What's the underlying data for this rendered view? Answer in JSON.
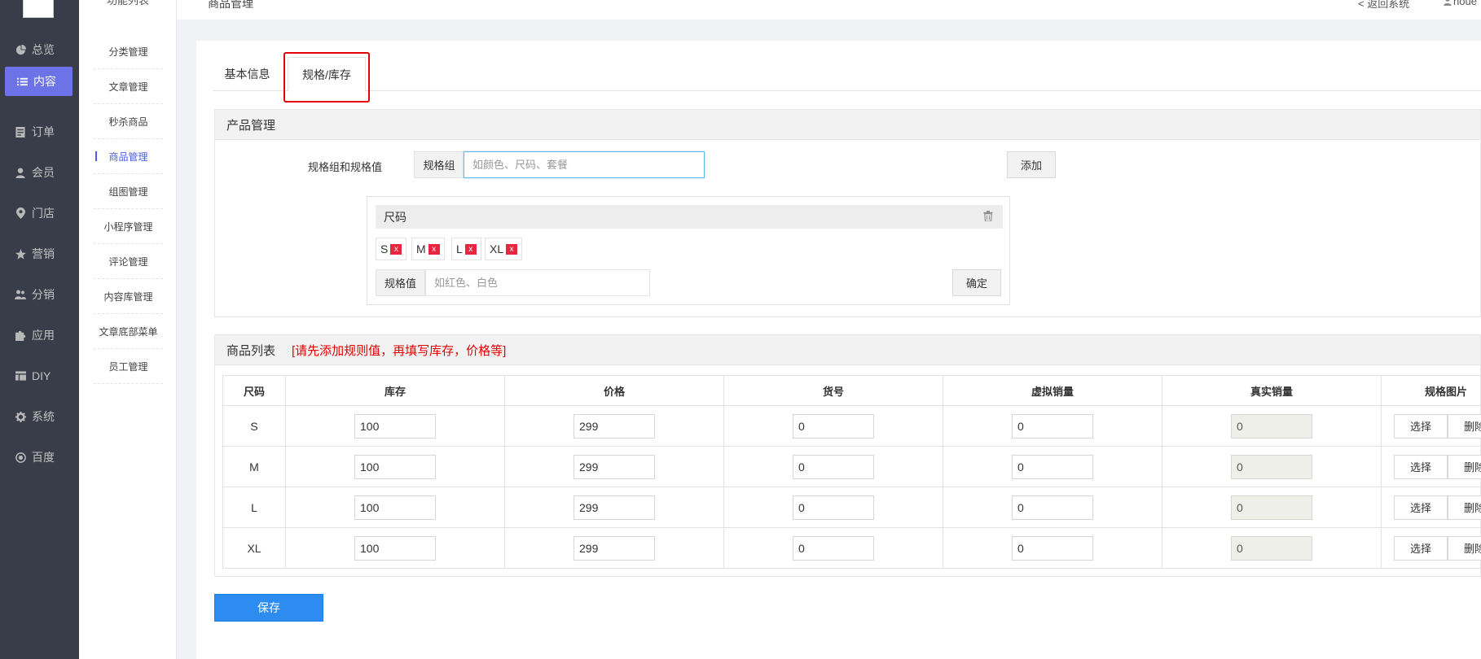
{
  "nav": {
    "items": [
      {
        "label": "总览",
        "icon": "pie-chart-icon"
      },
      {
        "label": "内容",
        "icon": "list-icon",
        "active": true
      },
      {
        "label": "订单",
        "icon": "document-icon"
      },
      {
        "label": "会员",
        "icon": "user-icon"
      },
      {
        "label": "门店",
        "icon": "location-pin-icon"
      },
      {
        "label": "营销",
        "icon": "star-icon"
      },
      {
        "label": "分销",
        "icon": "users-icon"
      },
      {
        "label": "应用",
        "icon": "puzzle-icon"
      },
      {
        "label": "DIY",
        "icon": "layout-icon"
      },
      {
        "label": "系统",
        "icon": "gear-icon"
      },
      {
        "label": "百度",
        "icon": "compass-icon"
      }
    ]
  },
  "submenu": {
    "title": "功能列表",
    "items": [
      "分类管理",
      "文章管理",
      "秒杀商品",
      "商品管理",
      "组图管理",
      "小程序管理",
      "评论管理",
      "内容库管理",
      "文章底部菜单",
      "员工管理"
    ]
  },
  "header": {
    "breadcrumb": "商品管理",
    "back": "< 返回系统",
    "user": "noue"
  },
  "tabs": {
    "basic": "基本信息",
    "spec": "规格/库存"
  },
  "product": {
    "title": "产品管理",
    "spec_label": "规格组和规格值",
    "group_addon": "规格组",
    "group_placeholder": "如颜色、尺码、套餐",
    "add_button": "添加",
    "group_name": "尺码",
    "values": [
      "S",
      "M",
      "L",
      "XL"
    ],
    "remove_glyph": "x",
    "value_addon": "规格值",
    "value_placeholder": "如红色、白色",
    "confirm_button": "确定"
  },
  "list": {
    "title": "商品列表",
    "warning": "[请先添加规则值，再填写库存，价格等]",
    "columns": [
      "尺码",
      "库存",
      "价格",
      "货号",
      "虚拟销量",
      "真实销量",
      "规格图片"
    ],
    "rows": [
      {
        "size": "S",
        "stock": "100",
        "price": "299",
        "sku": "0",
        "virtual": "0",
        "real": "0"
      },
      {
        "size": "M",
        "stock": "100",
        "price": "299",
        "sku": "0",
        "virtual": "0",
        "real": "0"
      },
      {
        "size": "L",
        "stock": "100",
        "price": "299",
        "sku": "0",
        "virtual": "0",
        "real": "0"
      },
      {
        "size": "XL",
        "stock": "100",
        "price": "299",
        "sku": "0",
        "virtual": "0",
        "real": "0"
      }
    ],
    "choose_label": "选择",
    "delete_label": "删除"
  },
  "save_label": "保存",
  "colors": {
    "nav_bg": "#393d49",
    "nav_active": "#6c73e6",
    "primary": "#2d8cf0",
    "warning": "#e60000",
    "chip_remove": "#e6273f"
  }
}
